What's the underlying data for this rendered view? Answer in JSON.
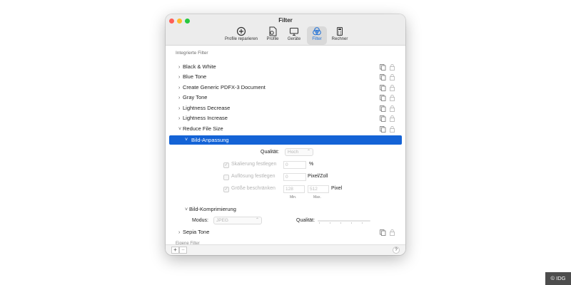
{
  "window": {
    "title": "Filter"
  },
  "toolbar": {
    "items": [
      {
        "label": "Profile reparieren",
        "icon": "plus-circle-icon"
      },
      {
        "label": "Profile",
        "icon": "profile-document-icon"
      },
      {
        "label": "Geräte",
        "icon": "display-icon"
      },
      {
        "label": "Filter",
        "icon": "color-filter-icon",
        "active": true
      },
      {
        "label": "Rechner",
        "icon": "calculator-icon"
      }
    ]
  },
  "section": {
    "header": "Integrierte Filter",
    "custom_header": "Eigene Filter"
  },
  "filters": [
    {
      "label": "Black & White"
    },
    {
      "label": "Blue Tone"
    },
    {
      "label": "Create Generic PDFX-3 Document"
    },
    {
      "label": "Gray Tone"
    },
    {
      "label": "Lightness Decrease"
    },
    {
      "label": "Lightness Increase"
    },
    {
      "label": "Reduce File Size",
      "expanded": true
    },
    {
      "label": "Sepia Tone"
    }
  ],
  "bild_anpassung": {
    "label": "Bild-Anpassung",
    "qualitaet_label": "Qualität:",
    "qualitaet_value": "Hoch",
    "skalierung_label": "Skalierung festlegen",
    "skalierung_value": "0",
    "skalierung_unit": "%",
    "aufloesung_label": "Auflösung festlegen",
    "aufloesung_value": "0",
    "aufloesung_unit": "Pixel/Zoll",
    "groesse_label": "Größe beschränken",
    "groesse_min": "128",
    "groesse_max": "512",
    "groesse_unit": "Pixel",
    "min_label": "Min.",
    "max_label": "Max."
  },
  "bild_komprimierung": {
    "label": "Bild-Komprimierung",
    "modus_label": "Modus:",
    "modus_value": "JPEG",
    "qualitaet_label": "Qualität:"
  },
  "bottom": {
    "add": "+",
    "remove": "−",
    "help": "?"
  },
  "credit": "© IDG",
  "colors": {
    "selection": "#1463d6",
    "active_tab": "#1a6ed8"
  }
}
